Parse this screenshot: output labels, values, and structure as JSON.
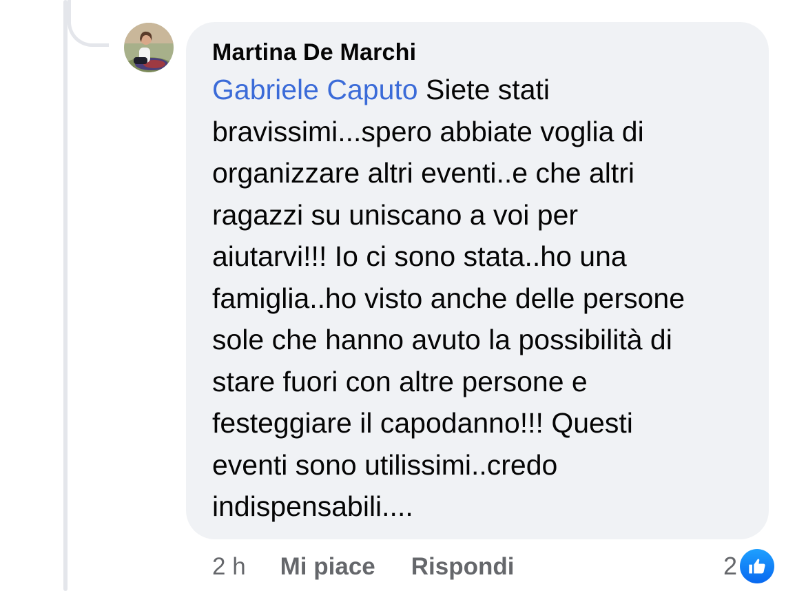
{
  "comment": {
    "author": "Martina De Marchi",
    "mention": "Gabriele Caputo",
    "lines": [
      " Siete stati",
      "bravissimi...spero abbiate voglia di",
      "organizzare altri eventi..e che altri",
      "ragazzi su uniscano a voi per",
      "aiutarvi!!! Io ci sono stata..ho una",
      "famiglia..ho visto anche delle persone",
      "sole che hanno avuto la possibilità di",
      "stare fuori con altre persone e",
      "festeggiare il capodanno!!! Questi",
      "eventi sono utilissimi..credo",
      "indispensabili...."
    ]
  },
  "actions": {
    "time": "2 h",
    "like_label": "Mi piace",
    "reply_label": "Rispondi"
  },
  "reactions": {
    "count": "2",
    "icon": "thumbs-up-icon",
    "color": "#1877f2"
  },
  "colors": {
    "bubble": "#f0f2f5",
    "mention": "#3b6bd8",
    "secondary_text": "#65676b"
  }
}
